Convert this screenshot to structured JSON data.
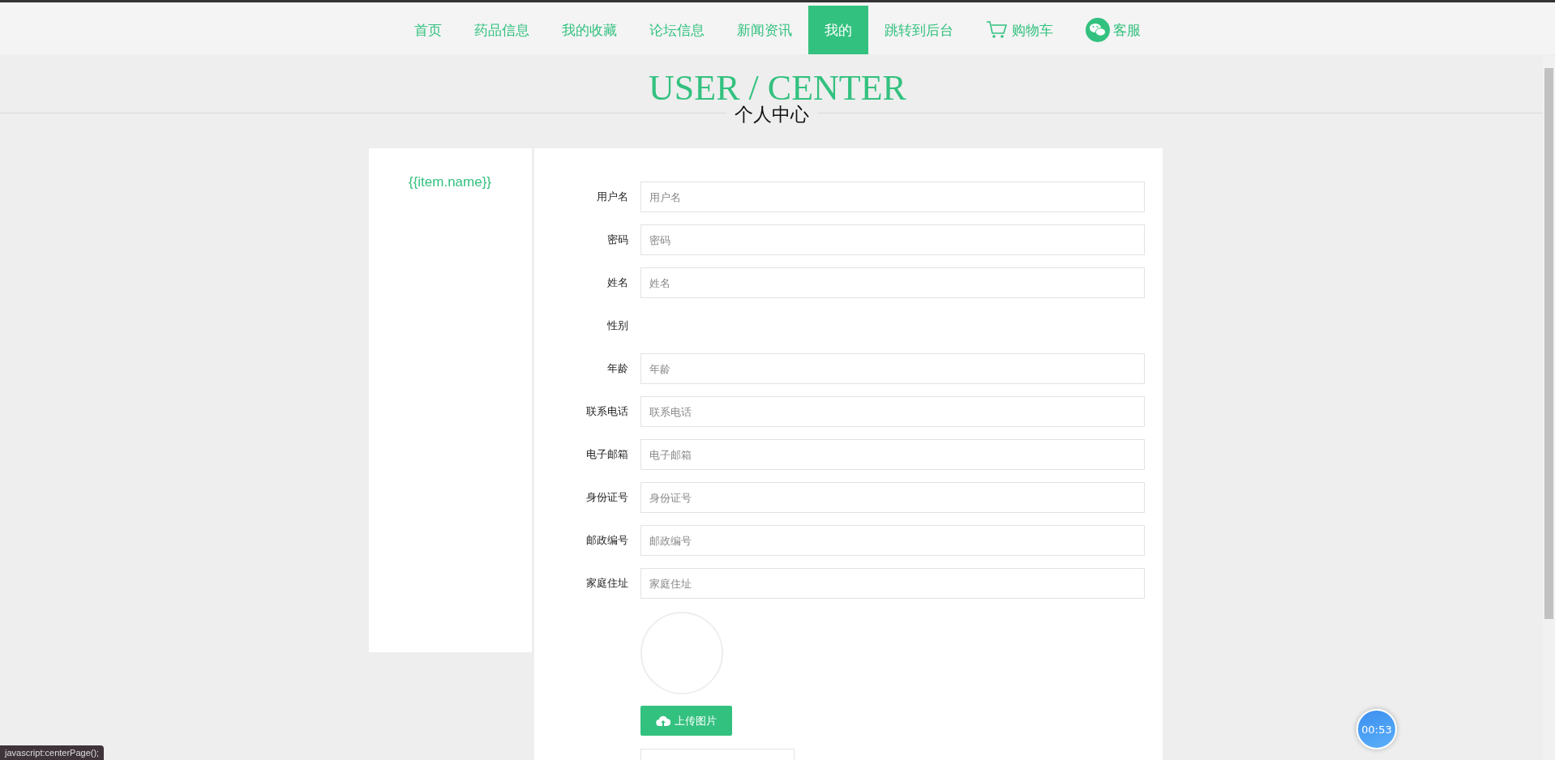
{
  "nav": {
    "items": [
      {
        "label": "首页",
        "selected": false,
        "kind": "text"
      },
      {
        "label": "药品信息",
        "selected": false,
        "kind": "text"
      },
      {
        "label": "我的收藏",
        "selected": false,
        "kind": "text"
      },
      {
        "label": "论坛信息",
        "selected": false,
        "kind": "text"
      },
      {
        "label": "新闻资讯",
        "selected": false,
        "kind": "text"
      },
      {
        "label": "我的",
        "selected": true,
        "kind": "text"
      },
      {
        "label": "跳转到后台",
        "selected": false,
        "kind": "text"
      },
      {
        "label": "购物车",
        "selected": false,
        "kind": "cart"
      },
      {
        "label": "客服",
        "selected": false,
        "kind": "chat"
      }
    ]
  },
  "header": {
    "title": "USER / CENTER",
    "subtitle": "个人中心"
  },
  "sidebar": {
    "items": [
      {
        "label": "{{item.name}}"
      }
    ]
  },
  "form": {
    "fields": [
      {
        "kind": "input",
        "label": "用户名",
        "placeholder": "用户名"
      },
      {
        "kind": "input",
        "label": "密码",
        "placeholder": "密码"
      },
      {
        "kind": "input",
        "label": "姓名",
        "placeholder": "姓名"
      },
      {
        "kind": "label",
        "label": "性别"
      },
      {
        "kind": "input",
        "label": "年龄",
        "placeholder": "年龄"
      },
      {
        "kind": "input",
        "label": "联系电话",
        "placeholder": "联系电话"
      },
      {
        "kind": "input",
        "label": "电子邮箱",
        "placeholder": "电子邮箱"
      },
      {
        "kind": "input",
        "label": "身份证号",
        "placeholder": "身份证号"
      },
      {
        "kind": "input",
        "label": "邮政编号",
        "placeholder": "邮政编号"
      },
      {
        "kind": "input",
        "label": "家庭住址",
        "placeholder": "家庭住址"
      }
    ],
    "upload_button": "上传图片"
  },
  "timer": "00:53",
  "status_bar": "javascript:centerPage();"
}
